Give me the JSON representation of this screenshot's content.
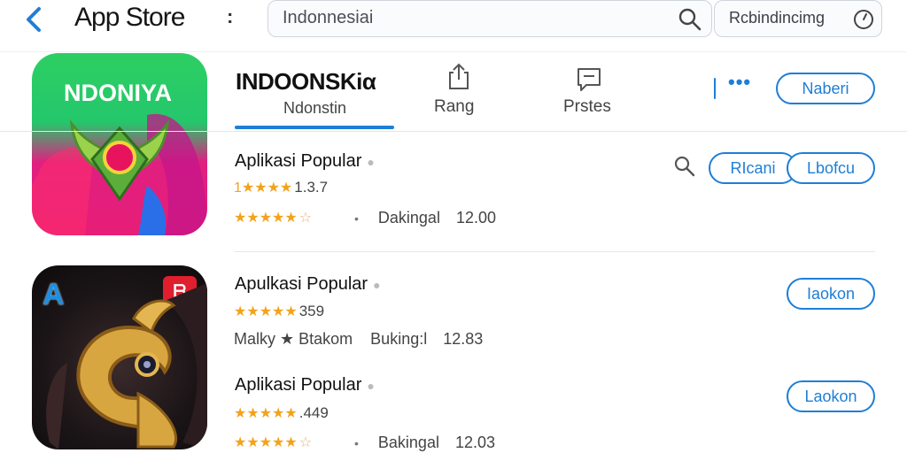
{
  "topbar": {
    "brand": "App Store",
    "menu_glyph": ":",
    "search_text": "Indonnesiai",
    "filter_text": "Rcbindincimg"
  },
  "header": {
    "icon_text": "NDONIYA",
    "title": "INDOONSKiα",
    "subtitle": "Ndonstin",
    "rating_label": "Rang",
    "posts_label": "Prstes",
    "more_glyph": "•••",
    "action_label": "Naberi"
  },
  "rows": [
    {
      "title": "Aplikasi Popular",
      "stars_text": "1★★★★",
      "rating_value": "1.3.7",
      "stars2_text": "★★★★★",
      "meta_label": "Dakingal",
      "meta_value": "12.00",
      "action_a": "RIcani",
      "action_b": "Lbofcu"
    },
    {
      "icon_badge_left": "A",
      "icon_badge_right": "ᗷ",
      "title": "Apulkasi Popular",
      "stars_text": "★★★★★",
      "rating_value": "359",
      "meta_left": "Malky ★ Btakom",
      "meta_label": "Buking:l",
      "meta_value": "12.83",
      "action": "Iaokon"
    },
    {
      "title": "Aplikasi Popular",
      "stars_text": "★★★★★",
      "rating_value": ".449",
      "stars2_text": "★★★★★",
      "meta_label": "Bakingal",
      "meta_value": "12.03",
      "action": "Laokon"
    }
  ],
  "colors": {
    "accent": "#1f7ed6",
    "star": "#f2a31b",
    "icon1_top": "#2dcf63",
    "icon1_bottom": "#e01f80"
  }
}
